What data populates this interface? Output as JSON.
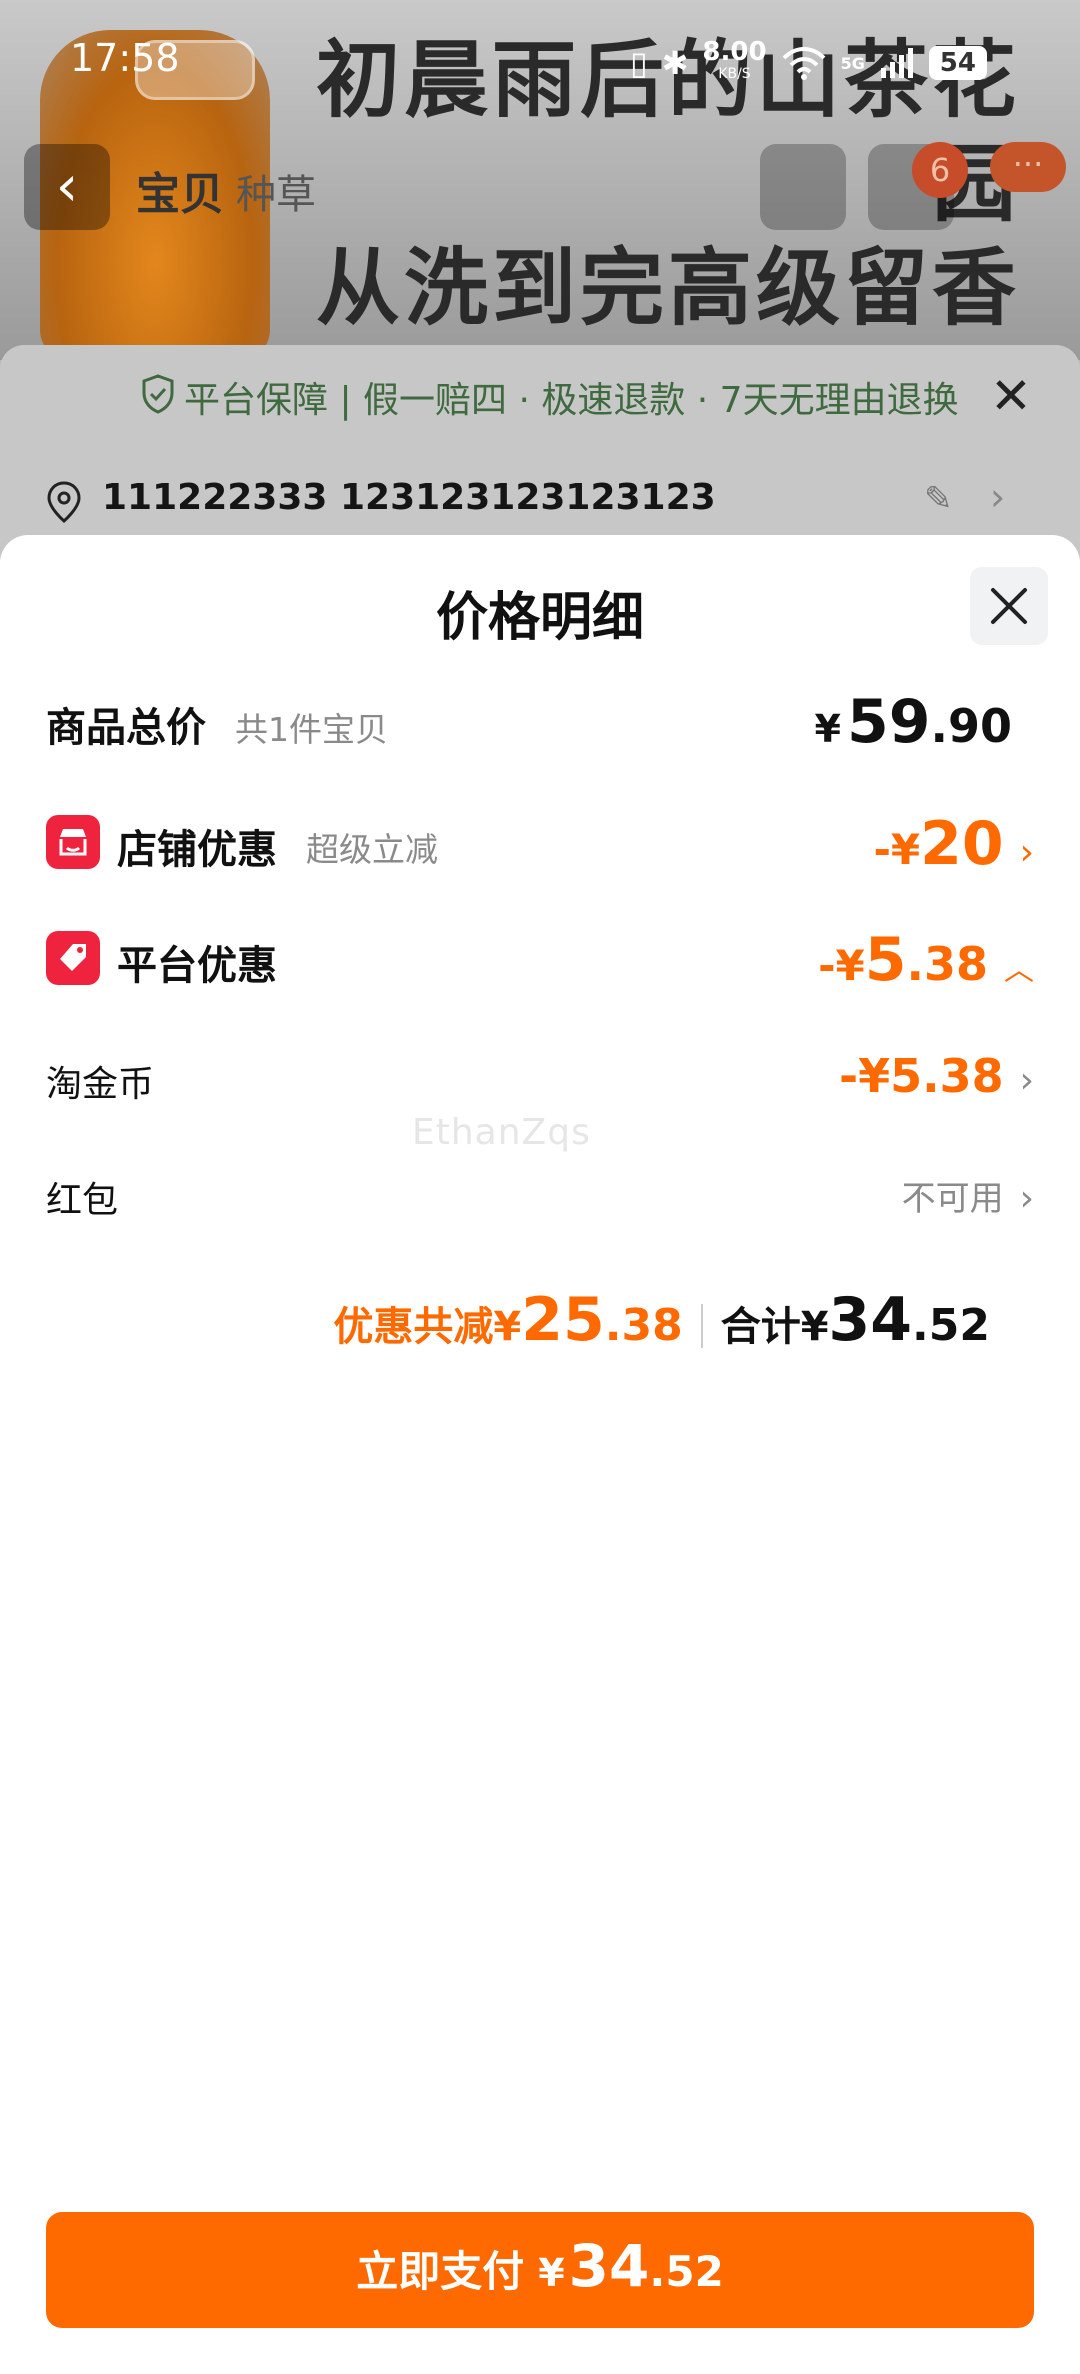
{
  "status_bar": {
    "time": "17:58",
    "net_speed": "8.00",
    "net_unit": "KB/S",
    "network_type": "5G",
    "battery": "54"
  },
  "background": {
    "slogan_line1": "初晨雨后的山茶花园",
    "slogan_line2": "从洗到完高级留香",
    "tab_active": "宝贝",
    "tab_other": "种草",
    "cart_badge": "6",
    "guarantee": "平台保障 | 假一赔四 · 极速退款 · 7天无理由退换",
    "address": "111222333 123123123123123"
  },
  "sheet": {
    "title": "价格明细",
    "total": {
      "label": "商品总价",
      "sub": "共1件宝贝",
      "currency": "¥",
      "int": "59",
      "dec": ".90"
    },
    "store_discount": {
      "label": "店铺优惠",
      "sub": "超级立减",
      "sign": "-¥",
      "int": "20",
      "dec": ""
    },
    "platform_discount": {
      "label": "平台优惠",
      "sign": "-¥",
      "int": "5",
      "dec": ".38"
    },
    "taojinbi": {
      "label": "淘金币",
      "value": "-¥5.38"
    },
    "hongbao": {
      "label": "红包",
      "value": "不可用"
    },
    "summary": {
      "discount_label": "优惠共减¥",
      "discount_int": "25",
      "discount_dec": ".38",
      "total_label": "合计¥",
      "total_int": "34",
      "total_dec": ".52"
    },
    "watermark": "EthanZqs"
  },
  "pay_button": {
    "label": "立即支付",
    "currency": "¥",
    "int": "34",
    "dec": ".52"
  },
  "colors": {
    "accent": "#ff6a00",
    "badge_red": "#f0233f"
  }
}
